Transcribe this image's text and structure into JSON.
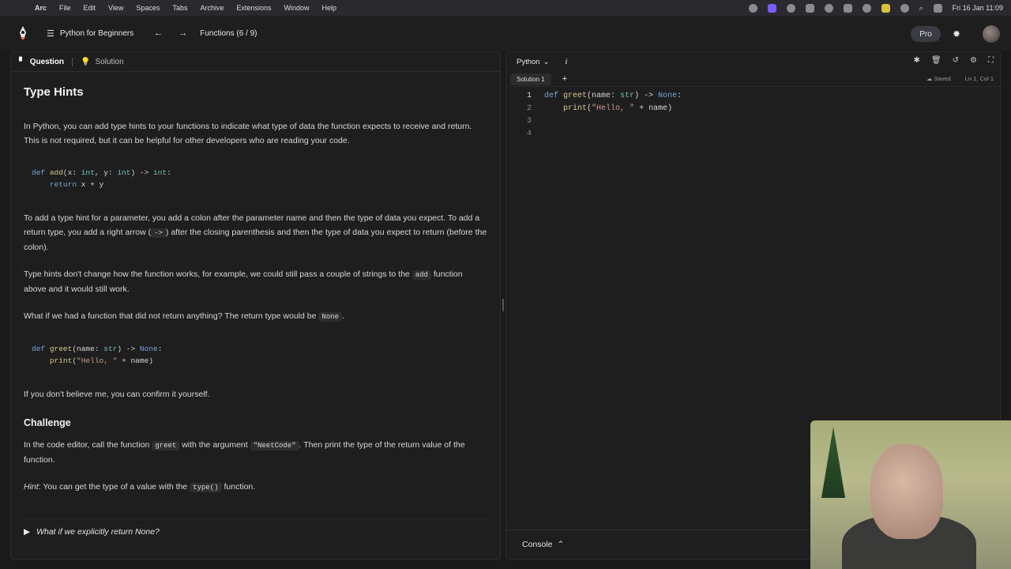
{
  "menubar": {
    "apple": "",
    "items": [
      "Arc",
      "File",
      "Edit",
      "View",
      "Spaces",
      "Tabs",
      "Archive",
      "Extensions",
      "Window",
      "Help"
    ],
    "datetime": "Fri 16 Jan 11:09"
  },
  "topbar": {
    "course_title": "Python for Beginners",
    "lesson_title": "Functions (6 / 9)",
    "pro_label": "Pro"
  },
  "left_panel": {
    "tab_question": "Question",
    "tab_solution": "Solution",
    "title": "Type Hints",
    "p1": "In Python, you can add type hints to your functions to indicate what type of data the function expects to receive and return. This is not required, but it can be helpful for other developers who are reading your code.",
    "code1": {
      "line1_kw": "def",
      "line1_fn": "add",
      "line1_args": "(x: ",
      "line1_t1": "int",
      "line1_mid": ", y: ",
      "line1_t2": "int",
      "line1_arrow": ") -> ",
      "line1_t3": "int",
      "line1_end": ":",
      "line2_kw": "return",
      "line2_rest": " x + y"
    },
    "p2_a": "To add a type hint for a parameter, you add a colon after the parameter name and then the type of data you expect. To add a return type, you add a right arrow (",
    "p2_code": "->",
    "p2_b": ") after the closing parenthesis and then the type of data you expect to return (before the colon).",
    "p3_a": "Type hints don't change how the function works, for example, we could still pass a couple of strings to the ",
    "p3_code": "add",
    "p3_b": " function above and it would still work.",
    "p4_a": "What if we had a function that did not return anything? The return type would be ",
    "p4_code": "None",
    "p4_b": ".",
    "code2": {
      "line1_kw": "def",
      "line1_fn": "greet",
      "line1_args": "(name: ",
      "line1_t1": "str",
      "line1_arrow": ") -> ",
      "line1_none": "None",
      "line1_end": ":",
      "line2_fn": "print",
      "line2_open": "(",
      "line2_str": "\"Hello, \"",
      "line2_rest": " + name)"
    },
    "p5": "If you don't believe me, you can confirm it yourself.",
    "challenge_title": "Challenge",
    "c1_a": "In the code editor, call the function ",
    "c1_code1": "greet",
    "c1_b": " with the argument ",
    "c1_code2": "\"NeetCode\"",
    "c1_c": ". Then print the type of the return value of the function.",
    "hint_label": "Hint",
    "hint_a": ": You can get the type of a value with the ",
    "hint_code": "type()",
    "hint_b": " function.",
    "details_summary": "What if we explicitly return None?"
  },
  "editor": {
    "language": "Python",
    "info": "i",
    "tab": "Solution 1",
    "add_tab": "+",
    "saved": "Saved",
    "position": "Ln 1, Col 1",
    "line_numbers": [
      "1",
      "2",
      "3",
      "4"
    ],
    "l1_kw": "def",
    "l1_fn": "greet",
    "l1_args": "(name: ",
    "l1_t": "str",
    "l1_arrow": ") -> ",
    "l1_none": "None",
    "l1_end": ":",
    "l2_indent": "    ",
    "l2_fn": "print",
    "l2_open": "(",
    "l2_str": "\"Hello, \"",
    "l2_rest": " + name)",
    "console_label": "Console"
  }
}
